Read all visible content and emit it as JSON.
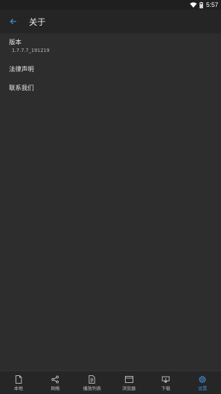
{
  "status": {
    "time": "5:57"
  },
  "appbar": {
    "title": "关于",
    "back_icon": "arrow-left-icon"
  },
  "items": {
    "version": {
      "label": "版本",
      "value": "1.7.7.7_191219"
    },
    "legal": {
      "label": "法律声明"
    },
    "contact": {
      "label": "联系我们"
    }
  },
  "nav": [
    {
      "label": "本地",
      "icon": "file-icon",
      "active": false
    },
    {
      "label": "网络",
      "icon": "share-icon",
      "active": false
    },
    {
      "label": "播放列表",
      "icon": "playlist-icon",
      "active": false
    },
    {
      "label": "浏览器",
      "icon": "browser-icon",
      "active": false
    },
    {
      "label": "下载",
      "icon": "download-icon",
      "active": false
    },
    {
      "label": "设置",
      "icon": "gear-icon",
      "active": true
    }
  ],
  "colors": {
    "accent": "#3d8fd6",
    "background": "#2d2d2d",
    "appbar": "#252525"
  }
}
